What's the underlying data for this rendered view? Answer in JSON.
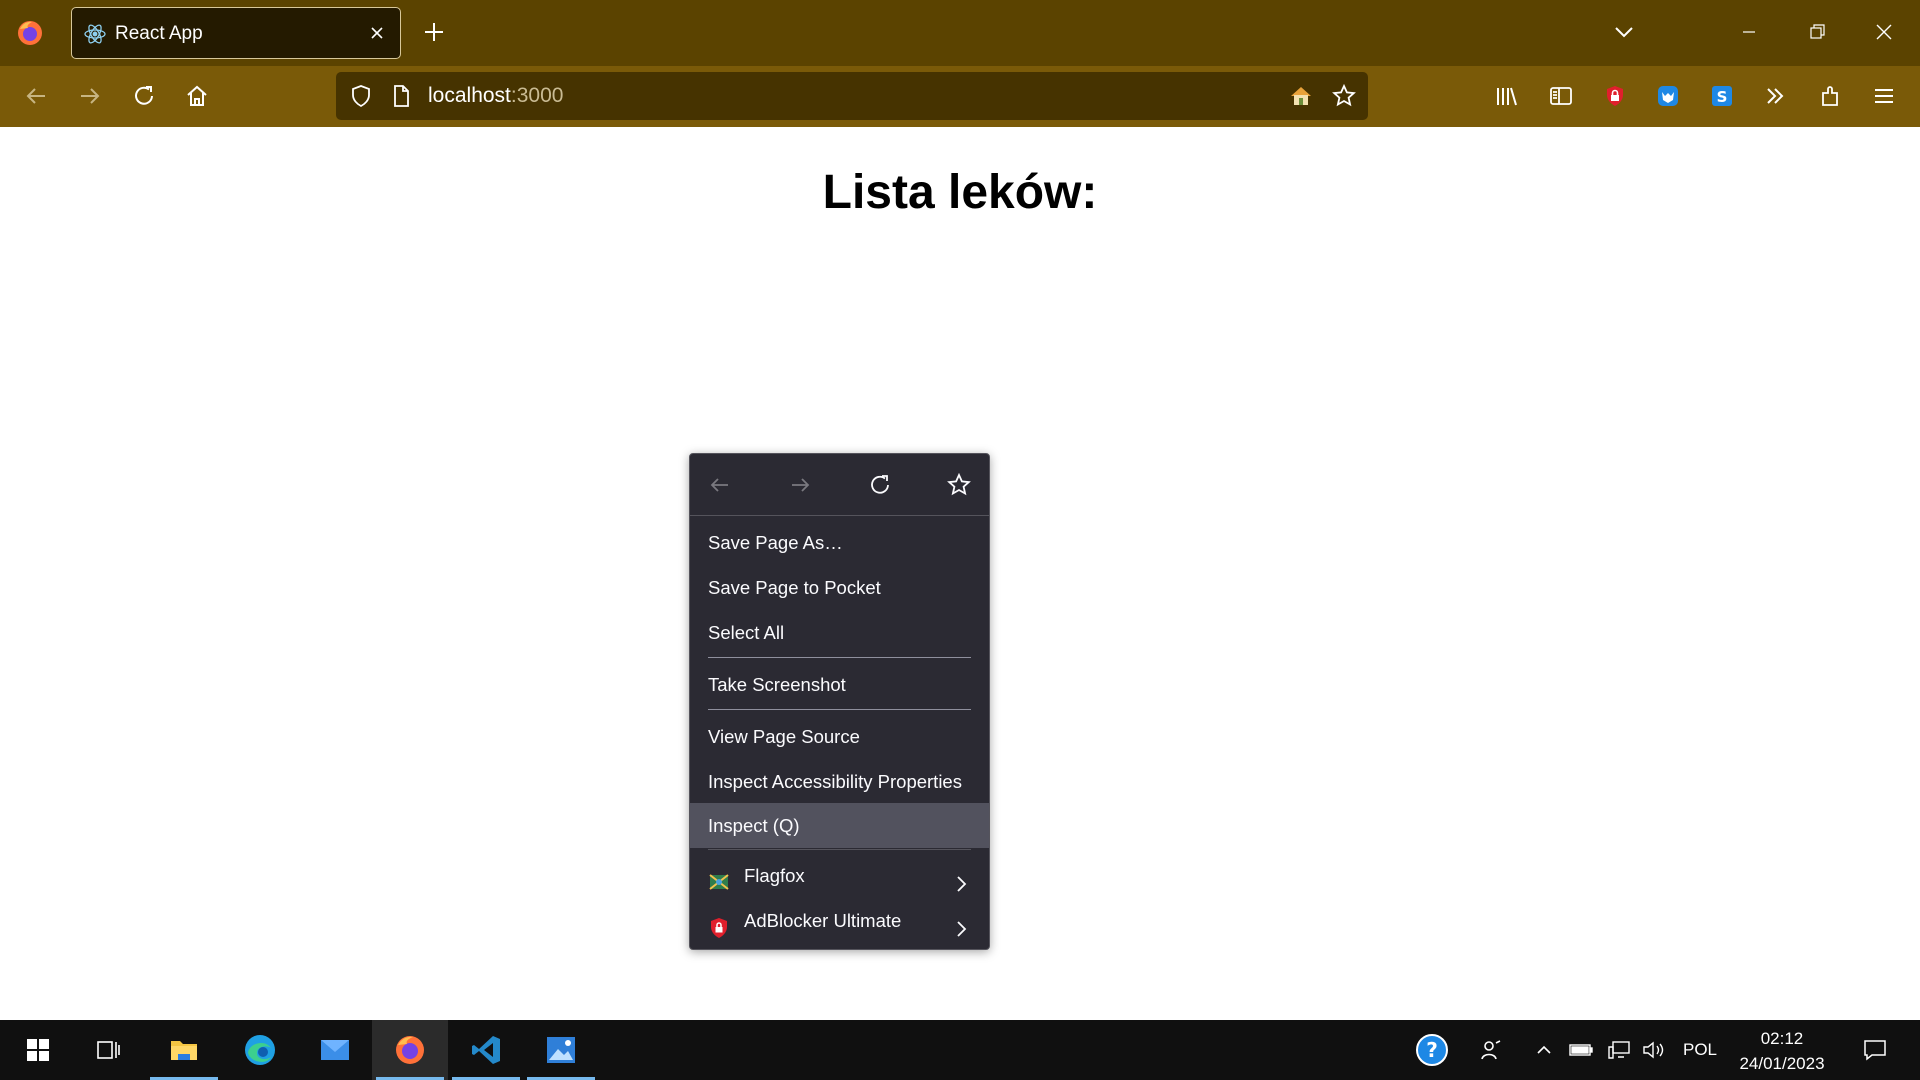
{
  "browser": {
    "tab": {
      "title": "React App"
    },
    "url": {
      "host": "localhost",
      "port": ":3000"
    }
  },
  "page": {
    "heading": "Lista leków:"
  },
  "context_menu": {
    "items": [
      {
        "label": "Save Page As…"
      },
      {
        "label": "Save Page to Pocket"
      },
      {
        "label": "Select All"
      },
      {
        "label": "Take Screenshot"
      },
      {
        "label": "View Page Source"
      },
      {
        "label": "Inspect Accessibility Properties"
      },
      {
        "label": "Inspect (Q)"
      },
      {
        "label": "Flagfox"
      },
      {
        "label": "AdBlocker Ultimate"
      }
    ],
    "highlighted_item": "Inspect (Q)"
  },
  "taskbar": {
    "language": "POL",
    "time": "02:12",
    "date": "24/01/2023"
  },
  "colors": {
    "tab_strip": "#5b4300",
    "toolbar": "#7a5a08",
    "menu_bg": "#2b2a33",
    "menu_highlight": "#52525e",
    "taskbar": "#101010"
  }
}
